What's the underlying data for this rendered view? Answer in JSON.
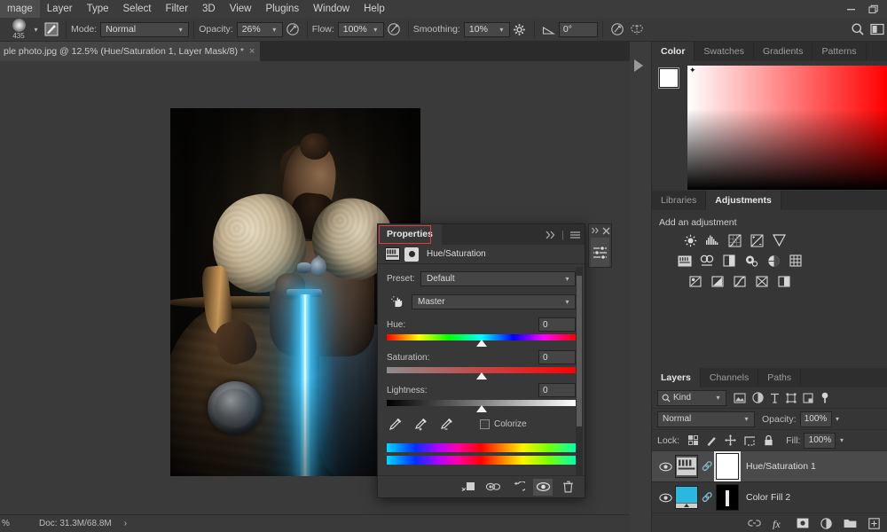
{
  "menubar": {
    "items": [
      "mage",
      "Layer",
      "Type",
      "Select",
      "Filter",
      "3D",
      "View",
      "Plugins",
      "Window",
      "Help"
    ],
    "window_controls": [
      "minimize-button",
      "restore-button"
    ]
  },
  "options_bar": {
    "brush_size": "435",
    "mode_label": "Mode:",
    "mode_value": "Normal",
    "opacity_label": "Opacity:",
    "opacity_value": "26%",
    "flow_label": "Flow:",
    "flow_value": "100%",
    "smoothing_label": "Smoothing:",
    "smoothing_value": "10%",
    "angle_value": "0°"
  },
  "document_tab": {
    "title": "ple photo.jpg @ 12.5% (Hue/Saturation 1, Layer Mask/8) *",
    "close": "×"
  },
  "status_bar": {
    "zoom": "%",
    "doc": "Doc: 31.3M/68.8M",
    "arrow": "›"
  },
  "properties_panel": {
    "tab_label": "Properties",
    "adjustment_name": "Hue/Saturation",
    "preset_label": "Preset:",
    "preset_value": "Default",
    "channel_value": "Master",
    "hue_label": "Hue:",
    "hue_value": "0",
    "saturation_label": "Saturation:",
    "saturation_value": "0",
    "lightness_label": "Lightness:",
    "lightness_value": "0",
    "colorize_label": "Colorize",
    "colorize_checked": false,
    "highlight_color": "#e23b3b",
    "footer_icons": [
      "clip-to-layer-icon",
      "view-previous-state-icon",
      "reset-icon",
      "toggle-visibility-icon",
      "delete-icon"
    ]
  },
  "color_panel": {
    "tabs": [
      "Color",
      "Swatches",
      "Gradients",
      "Patterns"
    ],
    "active_tab": "Color",
    "foreground_color": "#ffffff",
    "background_color": "#000000"
  },
  "adjustments_panel": {
    "tabs": [
      "Libraries",
      "Adjustments"
    ],
    "active_tab": "Adjustments",
    "heading": "Add an adjustment",
    "row1": [
      "brightness-contrast-icon",
      "levels-icon",
      "curves-icon",
      "exposure-icon",
      "vibrance-icon"
    ],
    "row2": [
      "hue-saturation-icon",
      "color-balance-icon",
      "black-white-icon",
      "photo-filter-icon",
      "channel-mixer-icon",
      "color-lookup-icon"
    ],
    "row3": [
      "invert-icon",
      "posterize-icon",
      "threshold-icon",
      "gradient-map-icon",
      "selective-color-icon"
    ]
  },
  "layers_panel": {
    "tabs": [
      "Layers",
      "Channels",
      "Paths"
    ],
    "active_tab": "Layers",
    "filter_label": "Kind",
    "filter_icons": [
      "pixel-filter-icon",
      "adjustment-filter-icon",
      "type-filter-icon",
      "shape-filter-icon",
      "smart-object-filter-icon",
      "filter-toggle-icon"
    ],
    "blend_mode": "Normal",
    "opacity_label": "Opacity:",
    "opacity_value": "100%",
    "lock_label": "Lock:",
    "lock_icons": [
      "lock-transparent-pixels-icon",
      "lock-image-pixels-icon",
      "lock-position-icon",
      "lock-artboard-icon",
      "lock-all-icon"
    ],
    "fill_label": "Fill:",
    "fill_value": "100%",
    "layers": [
      {
        "name": "Hue/Saturation 1",
        "visible": true,
        "selected": true,
        "thumb_type": "adjustment-thumbnail",
        "mask_color": "#ffffff",
        "mask_selected": true
      },
      {
        "name": "Color Fill 2",
        "visible": true,
        "selected": false,
        "thumb_type": "color-fill-thumbnail",
        "thumb_color": "#2bb8e0",
        "mask_color": "#000000",
        "mask_selected": false
      }
    ],
    "footer_icons": [
      "link-layers-icon",
      "layer-style-fx-icon",
      "add-mask-icon",
      "new-adjustment-icon",
      "new-group-icon",
      "new-layer-icon"
    ]
  }
}
